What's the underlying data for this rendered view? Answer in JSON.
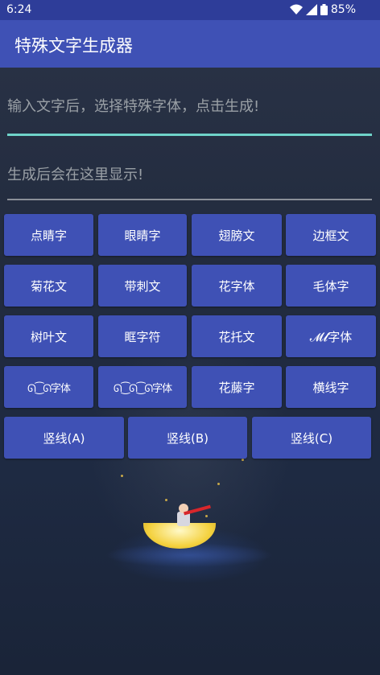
{
  "status_bar": {
    "time": "6:24",
    "battery": "85%"
  },
  "app_bar": {
    "title": "特殊文字生成器"
  },
  "input": {
    "placeholder": "输入文字后，选择特殊字体，点击生成!"
  },
  "output": {
    "placeholder": "生成后会在这里显示!"
  },
  "buttons": {
    "row1": [
      "点睛字",
      "眼睛字",
      "翅膀文",
      "边框文"
    ],
    "row2": [
      "菊花文",
      "带刺文",
      "花字体",
      "毛体字"
    ],
    "row3": [
      "树叶文",
      "眶字符",
      "花托文",
      "𝓜𝓵字体"
    ],
    "row4": [
      "ᘏ⁐ᘏ字体",
      "ᘏ⁐ᘏ⁐ᘏ字体",
      "花藤字",
      "横线字"
    ],
    "row5": [
      "竖线(A)",
      "竖线(B)",
      "竖线(C)"
    ]
  },
  "colors": {
    "primary": "#3f51b5",
    "status_bar": "#2e3d99",
    "accent": "#6fd3c9"
  }
}
